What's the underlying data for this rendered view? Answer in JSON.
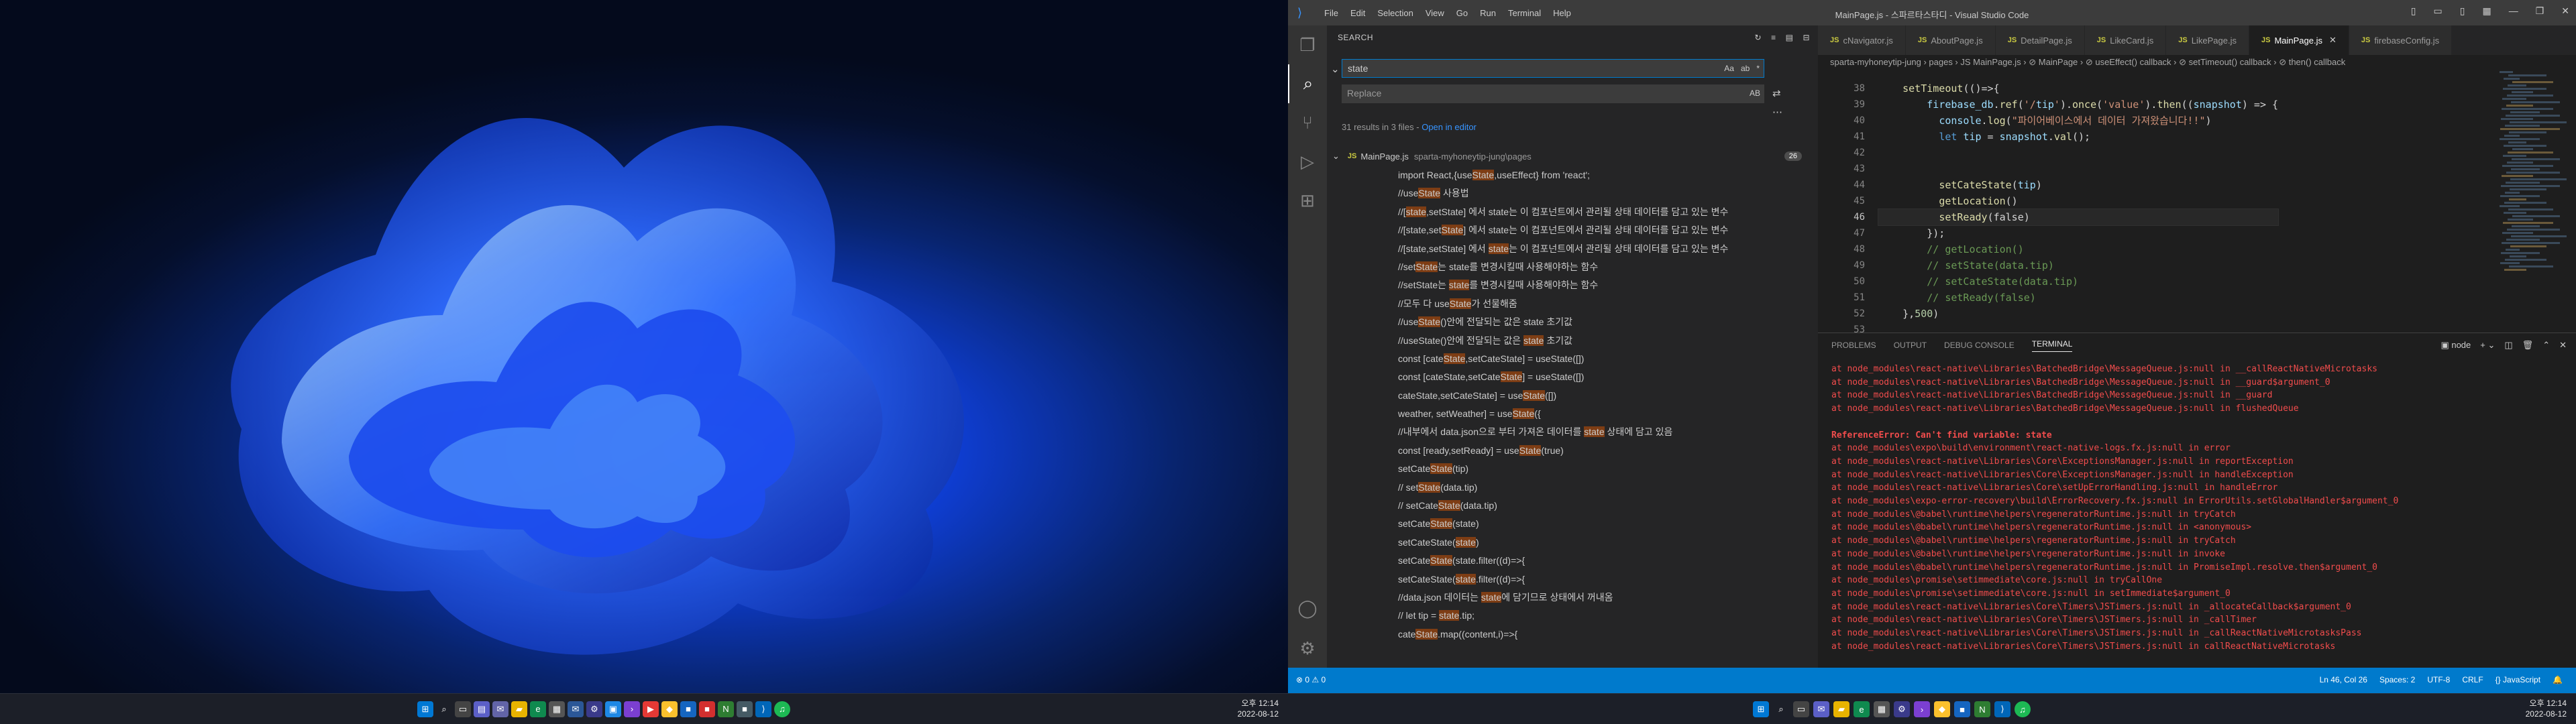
{
  "left_monitor": {
    "taskbar_icons": [
      "windows-start-icon",
      "search-icon",
      "task-view-icon",
      "widgets-icon",
      "chat-icon",
      "file-explorer-icon",
      "edge-icon",
      "store-icon",
      "mail-icon",
      "settings-icon",
      "photos-icon",
      "terminal-icon",
      "youtube-icon",
      "maps-icon",
      "app-icon",
      "app-icon",
      "notion-icon",
      "app-icon",
      "vscode-icon",
      "spotify-icon"
    ],
    "clock_time": "오후 12:14",
    "clock_date": "2022-08-12"
  },
  "vscode": {
    "window_title": "MainPage.js - 스파르타스타디 - Visual Studio Code",
    "menu": [
      "File",
      "Edit",
      "Selection",
      "View",
      "Go",
      "Run",
      "Terminal",
      "Help"
    ],
    "sidebar": {
      "header": "SEARCH",
      "search_value": "state",
      "search_opts": [
        "Aa",
        "ab",
        "*"
      ],
      "replace_placeholder": "Replace",
      "replace_opt": "AB",
      "summary": "31 results in 3 files - ",
      "open_in_editor": "Open in editor",
      "file_name": "MainPage.js",
      "file_path": "sparta-myhoneytip-jung\\pages",
      "file_badge": "26",
      "results": [
        {
          "pre": "import React,{use",
          "hl": "State",
          "post": ",useEffect} from 'react';"
        },
        {
          "pre": "//use",
          "hl": "State",
          "post": " 사용법"
        },
        {
          "pre": "//[",
          "hl": "state",
          "post": ",setState] 에서 state는 이 컴포넌트에서 관리될 상태 데이터를 담고 있는 변수"
        },
        {
          "pre": "//[state,set",
          "hl": "State",
          "post": "] 에서 state는 이 컴포넌트에서 관리될 상태 데이터를 담고 있는 변수"
        },
        {
          "pre": "//[state,setState] 에서 ",
          "hl": "state",
          "post": "는 이 컴포넌트에서 관리될 상태 데이터를 담고 있는 변수"
        },
        {
          "pre": "//set",
          "hl": "State",
          "post": "는 state를 변경시킬때 사용해야하는 함수"
        },
        {
          "pre": "//setState는 ",
          "hl": "state",
          "post": "를 변경시킬때 사용해야하는 함수"
        },
        {
          "pre": "//모두 다 use",
          "hl": "State",
          "post": "가 선물해줌"
        },
        {
          "pre": "//use",
          "hl": "State",
          "post": "()안에 전달되는 값은 state 초기값"
        },
        {
          "pre": "//useState()안에 전달되는 값은 ",
          "hl": "state",
          "post": " 초기값"
        },
        {
          "pre": "const [cate",
          "hl": "State",
          "post": ",setCateState] = useState([])"
        },
        {
          "pre": "const [cateState,setCate",
          "hl": "State",
          "post": "] = useState([])"
        },
        {
          "pre": "cateState,setCateState] = use",
          "hl": "State",
          "post": "([])"
        },
        {
          "pre": "weather, setWeather] = use",
          "hl": "State",
          "post": "({"
        },
        {
          "pre": "//내부에서 data.json으로 부터 가져온 데이터를 ",
          "hl": "state",
          "post": " 상태에 담고 있음"
        },
        {
          "pre": "const [ready,setReady] = use",
          "hl": "State",
          "post": "(true)"
        },
        {
          "pre": "setCate",
          "hl": "State",
          "post": "(tip)"
        },
        {
          "pre": "// set",
          "hl": "State",
          "post": "(data.tip)"
        },
        {
          "pre": "// setCate",
          "hl": "State",
          "post": "(data.tip)"
        },
        {
          "pre": "setCate",
          "hl": "State",
          "post": "(state)"
        },
        {
          "pre": "setCateState(",
          "hl": "state",
          "post": ")"
        },
        {
          "pre": "setCate",
          "hl": "State",
          "post": "(state.filter((d)=>{"
        },
        {
          "pre": "setCateState(",
          "hl": "state",
          "post": ".filter((d)=>{"
        },
        {
          "pre": "//data.json 데이터는 ",
          "hl": "state",
          "post": "에 담기므로 상태에서 꺼내옴"
        },
        {
          "pre": "// let tip = ",
          "hl": "state",
          "post": ".tip;"
        },
        {
          "pre": "cate",
          "hl": "State",
          "post": ".map((content,i)=>{"
        }
      ]
    },
    "tabs": [
      {
        "label": "cNavigator.js",
        "active": false
      },
      {
        "label": "AboutPage.js",
        "active": false
      },
      {
        "label": "DetailPage.js",
        "active": false
      },
      {
        "label": "LikeCard.js",
        "active": false
      },
      {
        "label": "LikePage.js",
        "active": false
      },
      {
        "label": "MainPage.js",
        "active": true
      },
      {
        "label": "firebaseConfig.js",
        "active": false
      }
    ],
    "breadcrumb": "sparta-myhoneytip-jung › pages › JS MainPage.js › ⊘ MainPage › ⊘ useEffect() callback › ⊘ setTimeout() callback › ⊘ then() callback",
    "code_lines": [
      {
        "n": "38",
        "t": "    setTimeout(()=>{"
      },
      {
        "n": "39",
        "t": "        firebase_db.ref('/tip').once('value').then((snapshot) => {"
      },
      {
        "n": "40",
        "t": "          console.log(\"파이어베이스에서 데이터 가져왔습니다!!\")"
      },
      {
        "n": "41",
        "t": "          let tip = snapshot.val();"
      },
      {
        "n": "42",
        "t": ""
      },
      {
        "n": "43",
        "t": ""
      },
      {
        "n": "44",
        "t": "          setCateState(tip)"
      },
      {
        "n": "45",
        "t": "          getLocation()"
      },
      {
        "n": "46",
        "t": "          setReady(false)"
      },
      {
        "n": "47",
        "t": "        });"
      },
      {
        "n": "48",
        "t": "        // getLocation()"
      },
      {
        "n": "49",
        "t": "        // setState(data.tip)"
      },
      {
        "n": "50",
        "t": "        // setCateState(data.tip)"
      },
      {
        "n": "51",
        "t": "        // setReady(false)"
      },
      {
        "n": "52",
        "t": "    },500)"
      },
      {
        "n": "53",
        "t": ""
      }
    ],
    "panel_tabs": [
      "PROBLEMS",
      "OUTPUT",
      "DEBUG CONSOLE",
      "TERMINAL"
    ],
    "terminal_shell": "node",
    "terminal_lines": [
      "at node_modules\\react-native\\Libraries\\BatchedBridge\\MessageQueue.js:null in __callReactNativeMicrotasks",
      "at node_modules\\react-native\\Libraries\\BatchedBridge\\MessageQueue.js:null in __guard$argument_0",
      "at node_modules\\react-native\\Libraries\\BatchedBridge\\MessageQueue.js:null in __guard",
      "at node_modules\\react-native\\Libraries\\BatchedBridge\\MessageQueue.js:null in flushedQueue",
      "",
      "ReferenceError: Can't find variable: state",
      "at node_modules\\expo\\build\\environment\\react-native-logs.fx.js:null in error",
      "at node_modules\\react-native\\Libraries\\Core\\ExceptionsManager.js:null in reportException",
      "at node_modules\\react-native\\Libraries\\Core\\ExceptionsManager.js:null in handleException",
      "at node_modules\\react-native\\Libraries\\Core\\setUpErrorHandling.js:null in handleError",
      "at node_modules\\expo-error-recovery\\build\\ErrorRecovery.fx.js:null in ErrorUtils.setGlobalHandler$argument_0",
      "at node_modules\\@babel\\runtime\\helpers\\regeneratorRuntime.js:null in tryCatch",
      "at node_modules\\@babel\\runtime\\helpers\\regeneratorRuntime.js:null in <anonymous>",
      "at node_modules\\@babel\\runtime\\helpers\\regeneratorRuntime.js:null in tryCatch",
      "at node_modules\\@babel\\runtime\\helpers\\regeneratorRuntime.js:null in invoke",
      "at node_modules\\@babel\\runtime\\helpers\\regeneratorRuntime.js:null in PromiseImpl.resolve.then$argument_0",
      "at node_modules\\promise\\setimmediate\\core.js:null in tryCallOne",
      "at node_modules\\promise\\setimmediate\\core.js:null in setImmediate$argument_0",
      "at node_modules\\react-native\\Libraries\\Core\\Timers\\JSTimers.js:null in _allocateCallback$argument_0",
      "at node_modules\\react-native\\Libraries\\Core\\Timers\\JSTimers.js:null in _callTimer",
      "at node_modules\\react-native\\Libraries\\Core\\Timers\\JSTimers.js:null in _callReactNativeMicrotasksPass",
      "at node_modules\\react-native\\Libraries\\Core\\Timers\\JSTimers.js:null in callReactNativeMicrotasks"
    ],
    "status_left": "⊗ 0 ⚠ 0",
    "status_right": [
      "Ln 46, Col 26",
      "Spaces: 2",
      "UTF-8",
      "CRLF",
      "{} JavaScript"
    ],
    "clock_time": "오후 12:14",
    "clock_date": "2022-08-12"
  }
}
